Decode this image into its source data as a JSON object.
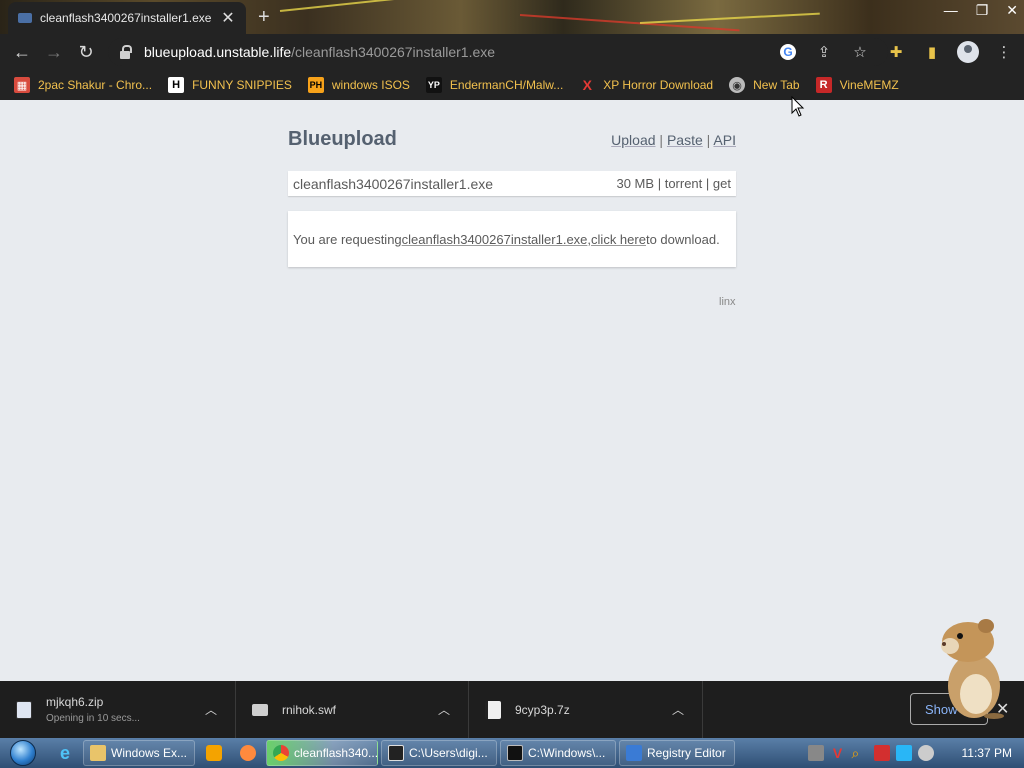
{
  "browser": {
    "tab_title": "cleanflash3400267installer1.exe",
    "url_host": "blueupload.unstable.life",
    "url_path": "/cleanflash3400267installer1.exe"
  },
  "bookmarks": [
    {
      "label": "2pac Shakur - Chro...",
      "icon": "calendar-icon"
    },
    {
      "label": "FUNNY SNIPPIES",
      "icon": "H"
    },
    {
      "label": "windows ISOS",
      "icon": "PH"
    },
    {
      "label": "EndermanCH/Malw...",
      "icon": "YP"
    },
    {
      "label": "XP Horror Download",
      "icon": "X"
    },
    {
      "label": "New Tab",
      "icon": "globe-icon"
    },
    {
      "label": "VineMEMZ",
      "icon": "R"
    }
  ],
  "site": {
    "title": "Blueupload",
    "nav_upload": "Upload",
    "nav_paste": "Paste",
    "nav_api": "API",
    "sep": "|"
  },
  "file": {
    "name": "cleanflash3400267installer1.exe",
    "size": "30 MB",
    "torrent": "torrent",
    "get": "get"
  },
  "notice": {
    "prefix": "You are requesting ",
    "filename": "cleanflash3400267installer1.exe",
    "comma": ", ",
    "click": "click here",
    "suffix": " to download."
  },
  "footer": {
    "linx": "linx"
  },
  "downloads": [
    {
      "name": "mjkqh6.zip",
      "status": "Opening in 10 secs..."
    },
    {
      "name": "rnihok.swf",
      "status": ""
    },
    {
      "name": "9cyp3p.7z",
      "status": ""
    }
  ],
  "shelf": {
    "show_all": "Show all"
  },
  "taskbar": {
    "apps": [
      {
        "label": "Windows Ex...",
        "color": "#e9c46a"
      },
      {
        "label": "cleanflash340...",
        "color": "#4285f4"
      },
      {
        "label": "C:\\Users\\digi...",
        "color": "#222222"
      },
      {
        "label": "C:\\Windows\\...",
        "color": "#111111"
      },
      {
        "label": "Registry Editor",
        "color": "#3a7bd5"
      }
    ],
    "clock": "11:37 PM"
  },
  "colors": {
    "accent": "#556170",
    "bookmark": "#f2c14e",
    "page_bg": "#e8ebef"
  }
}
